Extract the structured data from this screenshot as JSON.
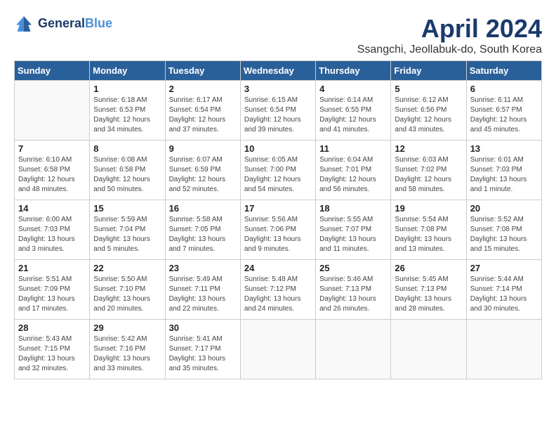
{
  "header": {
    "logo_line1": "General",
    "logo_line2": "Blue",
    "month_title": "April 2024",
    "location": "Ssangchi, Jeollabuk-do, South Korea"
  },
  "weekdays": [
    "Sunday",
    "Monday",
    "Tuesday",
    "Wednesday",
    "Thursday",
    "Friday",
    "Saturday"
  ],
  "weeks": [
    [
      {
        "day": "",
        "sunrise": "",
        "sunset": "",
        "daylight": ""
      },
      {
        "day": "1",
        "sunrise": "Sunrise: 6:18 AM",
        "sunset": "Sunset: 6:53 PM",
        "daylight": "Daylight: 12 hours and 34 minutes."
      },
      {
        "day": "2",
        "sunrise": "Sunrise: 6:17 AM",
        "sunset": "Sunset: 6:54 PM",
        "daylight": "Daylight: 12 hours and 37 minutes."
      },
      {
        "day": "3",
        "sunrise": "Sunrise: 6:15 AM",
        "sunset": "Sunset: 6:54 PM",
        "daylight": "Daylight: 12 hours and 39 minutes."
      },
      {
        "day": "4",
        "sunrise": "Sunrise: 6:14 AM",
        "sunset": "Sunset: 6:55 PM",
        "daylight": "Daylight: 12 hours and 41 minutes."
      },
      {
        "day": "5",
        "sunrise": "Sunrise: 6:12 AM",
        "sunset": "Sunset: 6:56 PM",
        "daylight": "Daylight: 12 hours and 43 minutes."
      },
      {
        "day": "6",
        "sunrise": "Sunrise: 6:11 AM",
        "sunset": "Sunset: 6:57 PM",
        "daylight": "Daylight: 12 hours and 45 minutes."
      }
    ],
    [
      {
        "day": "7",
        "sunrise": "Sunrise: 6:10 AM",
        "sunset": "Sunset: 6:58 PM",
        "daylight": "Daylight: 12 hours and 48 minutes."
      },
      {
        "day": "8",
        "sunrise": "Sunrise: 6:08 AM",
        "sunset": "Sunset: 6:58 PM",
        "daylight": "Daylight: 12 hours and 50 minutes."
      },
      {
        "day": "9",
        "sunrise": "Sunrise: 6:07 AM",
        "sunset": "Sunset: 6:59 PM",
        "daylight": "Daylight: 12 hours and 52 minutes."
      },
      {
        "day": "10",
        "sunrise": "Sunrise: 6:05 AM",
        "sunset": "Sunset: 7:00 PM",
        "daylight": "Daylight: 12 hours and 54 minutes."
      },
      {
        "day": "11",
        "sunrise": "Sunrise: 6:04 AM",
        "sunset": "Sunset: 7:01 PM",
        "daylight": "Daylight: 12 hours and 56 minutes."
      },
      {
        "day": "12",
        "sunrise": "Sunrise: 6:03 AM",
        "sunset": "Sunset: 7:02 PM",
        "daylight": "Daylight: 12 hours and 58 minutes."
      },
      {
        "day": "13",
        "sunrise": "Sunrise: 6:01 AM",
        "sunset": "Sunset: 7:03 PM",
        "daylight": "Daylight: 13 hours and 1 minute."
      }
    ],
    [
      {
        "day": "14",
        "sunrise": "Sunrise: 6:00 AM",
        "sunset": "Sunset: 7:03 PM",
        "daylight": "Daylight: 13 hours and 3 minutes."
      },
      {
        "day": "15",
        "sunrise": "Sunrise: 5:59 AM",
        "sunset": "Sunset: 7:04 PM",
        "daylight": "Daylight: 13 hours and 5 minutes."
      },
      {
        "day": "16",
        "sunrise": "Sunrise: 5:58 AM",
        "sunset": "Sunset: 7:05 PM",
        "daylight": "Daylight: 13 hours and 7 minutes."
      },
      {
        "day": "17",
        "sunrise": "Sunrise: 5:56 AM",
        "sunset": "Sunset: 7:06 PM",
        "daylight": "Daylight: 13 hours and 9 minutes."
      },
      {
        "day": "18",
        "sunrise": "Sunrise: 5:55 AM",
        "sunset": "Sunset: 7:07 PM",
        "daylight": "Daylight: 13 hours and 11 minutes."
      },
      {
        "day": "19",
        "sunrise": "Sunrise: 5:54 AM",
        "sunset": "Sunset: 7:08 PM",
        "daylight": "Daylight: 13 hours and 13 minutes."
      },
      {
        "day": "20",
        "sunrise": "Sunrise: 5:52 AM",
        "sunset": "Sunset: 7:08 PM",
        "daylight": "Daylight: 13 hours and 15 minutes."
      }
    ],
    [
      {
        "day": "21",
        "sunrise": "Sunrise: 5:51 AM",
        "sunset": "Sunset: 7:09 PM",
        "daylight": "Daylight: 13 hours and 17 minutes."
      },
      {
        "day": "22",
        "sunrise": "Sunrise: 5:50 AM",
        "sunset": "Sunset: 7:10 PM",
        "daylight": "Daylight: 13 hours and 20 minutes."
      },
      {
        "day": "23",
        "sunrise": "Sunrise: 5:49 AM",
        "sunset": "Sunset: 7:11 PM",
        "daylight": "Daylight: 13 hours and 22 minutes."
      },
      {
        "day": "24",
        "sunrise": "Sunrise: 5:48 AM",
        "sunset": "Sunset: 7:12 PM",
        "daylight": "Daylight: 13 hours and 24 minutes."
      },
      {
        "day": "25",
        "sunrise": "Sunrise: 5:46 AM",
        "sunset": "Sunset: 7:13 PM",
        "daylight": "Daylight: 13 hours and 26 minutes."
      },
      {
        "day": "26",
        "sunrise": "Sunrise: 5:45 AM",
        "sunset": "Sunset: 7:13 PM",
        "daylight": "Daylight: 13 hours and 28 minutes."
      },
      {
        "day": "27",
        "sunrise": "Sunrise: 5:44 AM",
        "sunset": "Sunset: 7:14 PM",
        "daylight": "Daylight: 13 hours and 30 minutes."
      }
    ],
    [
      {
        "day": "28",
        "sunrise": "Sunrise: 5:43 AM",
        "sunset": "Sunset: 7:15 PM",
        "daylight": "Daylight: 13 hours and 32 minutes."
      },
      {
        "day": "29",
        "sunrise": "Sunrise: 5:42 AM",
        "sunset": "Sunset: 7:16 PM",
        "daylight": "Daylight: 13 hours and 33 minutes."
      },
      {
        "day": "30",
        "sunrise": "Sunrise: 5:41 AM",
        "sunset": "Sunset: 7:17 PM",
        "daylight": "Daylight: 13 hours and 35 minutes."
      },
      {
        "day": "",
        "sunrise": "",
        "sunset": "",
        "daylight": ""
      },
      {
        "day": "",
        "sunrise": "",
        "sunset": "",
        "daylight": ""
      },
      {
        "day": "",
        "sunrise": "",
        "sunset": "",
        "daylight": ""
      },
      {
        "day": "",
        "sunrise": "",
        "sunset": "",
        "daylight": ""
      }
    ]
  ]
}
